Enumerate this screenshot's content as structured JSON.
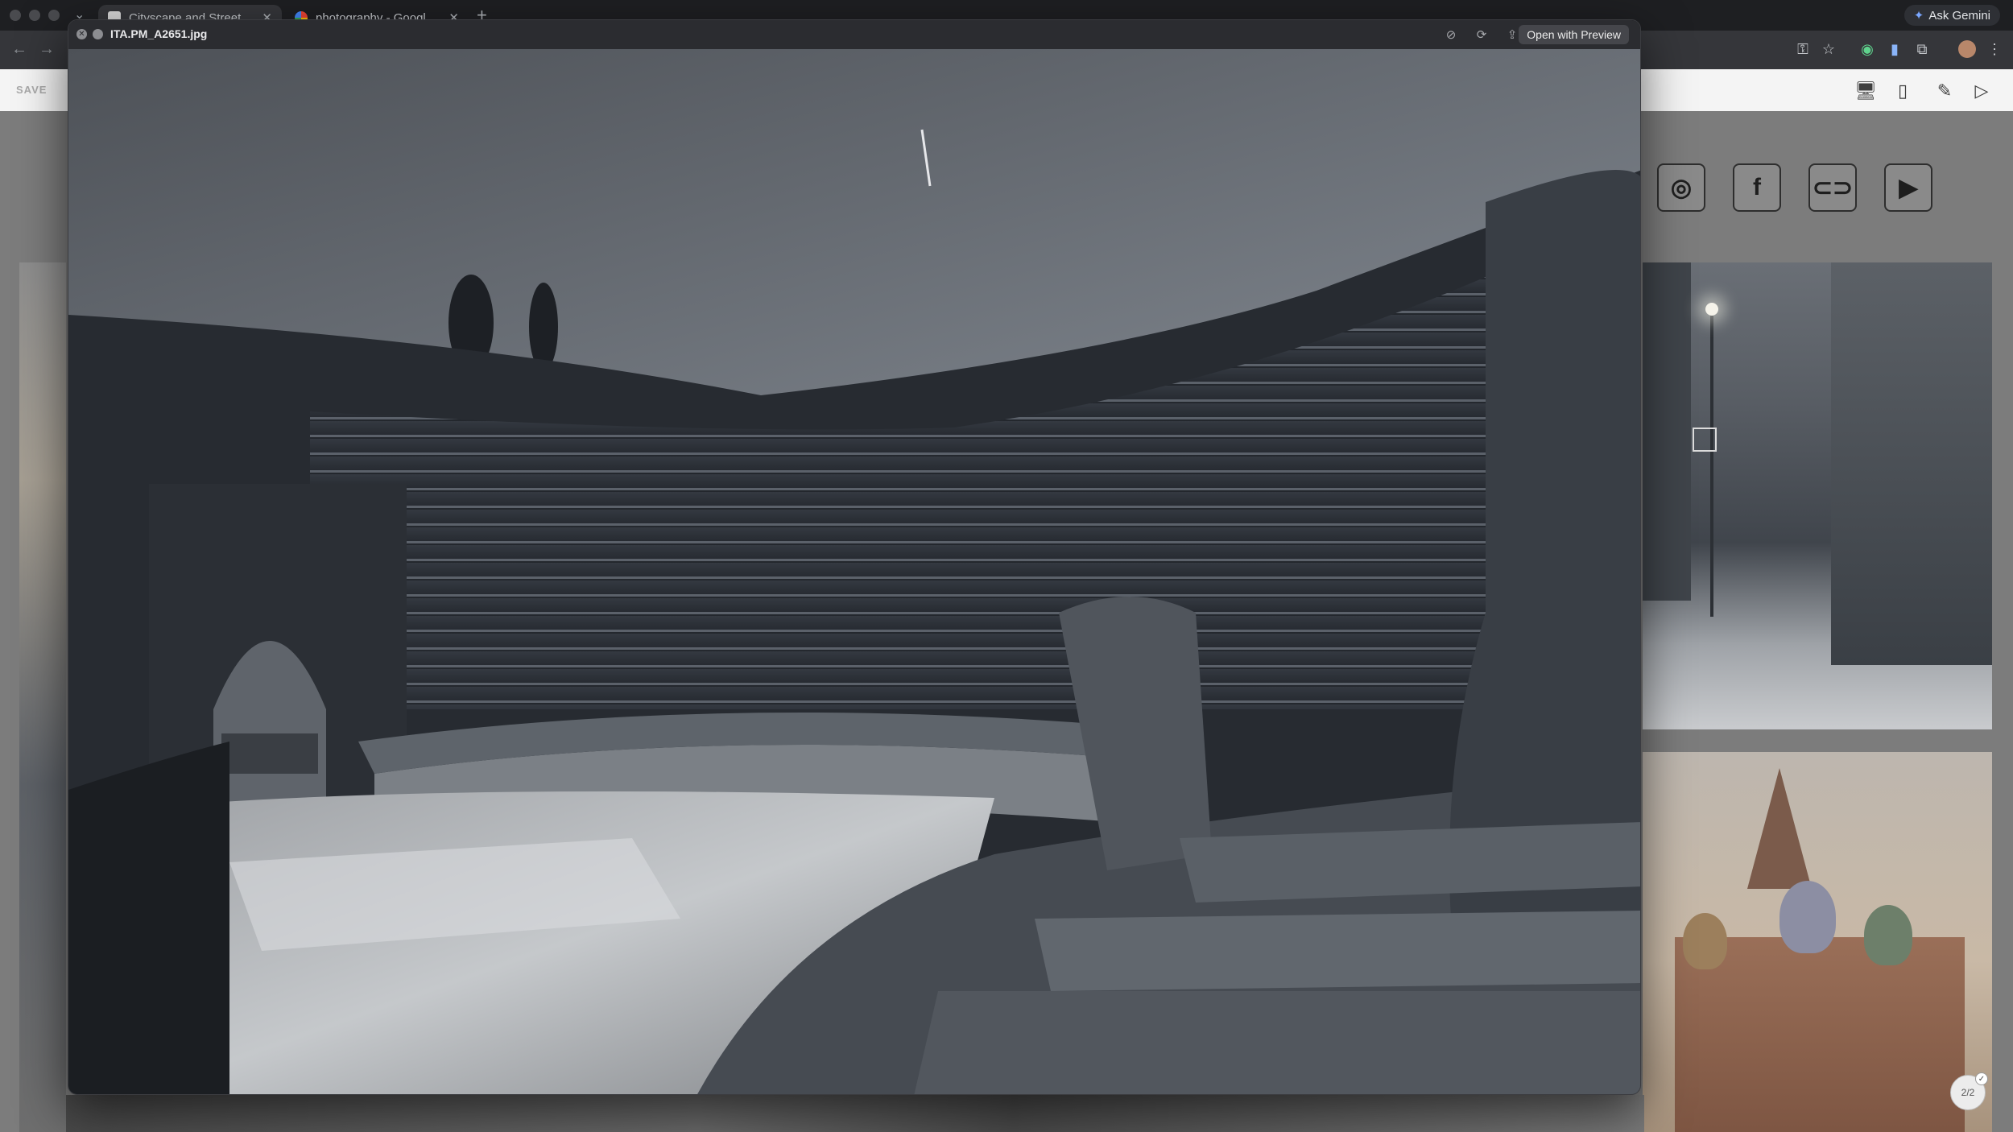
{
  "browser": {
    "tabs": [
      {
        "label": "Cityscape and Street Photog",
        "active": true
      },
      {
        "label": "photography - Google Search",
        "active": false
      }
    ],
    "new_tab": "+",
    "ask_gemini": "Ask Gemini"
  },
  "site": {
    "save_label": "SAVE",
    "social_icons": [
      "instagram-icon",
      "facebook-icon",
      "link-icon",
      "youtube-icon"
    ],
    "page_counter": "2/2"
  },
  "quicklook": {
    "filename": "ITA.PM_A2651.jpg",
    "open_button": "Open with Preview"
  }
}
